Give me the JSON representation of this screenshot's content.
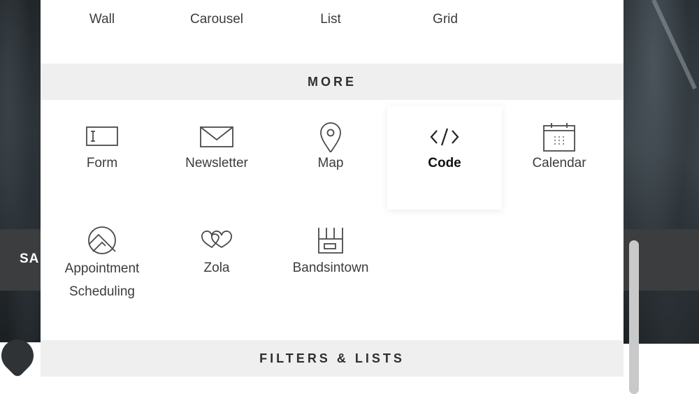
{
  "background": {
    "band_text": "SA"
  },
  "layouts": [
    {
      "label": "Wall",
      "icon": "wall-icon"
    },
    {
      "label": "Carousel",
      "icon": "carousel-icon"
    },
    {
      "label": "List",
      "icon": "list-icon"
    },
    {
      "label": "Grid",
      "icon": "grid-icon"
    }
  ],
  "more": {
    "header": "MORE",
    "items": [
      {
        "label": "Form",
        "icon": "form-icon"
      },
      {
        "label": "Newsletter",
        "icon": "envelope-icon"
      },
      {
        "label": "Map",
        "icon": "map-pin-icon"
      },
      {
        "label": "Code",
        "icon": "code-icon",
        "selected": true
      },
      {
        "label": "Calendar",
        "icon": "calendar-icon"
      },
      {
        "label_line1": "Appointment",
        "label_line2": "Scheduling",
        "icon": "appointment-icon"
      },
      {
        "label": "Zola",
        "icon": "zola-hearts-icon"
      },
      {
        "label": "Bandsintown",
        "icon": "bandsintown-icon"
      }
    ]
  },
  "filters": {
    "header": "FILTERS & LISTS"
  },
  "colors": {
    "header_bg": "#efefef",
    "text": "#3c3c3c",
    "selected_text": "#111111",
    "icon_stroke": "#4a4a4a"
  }
}
